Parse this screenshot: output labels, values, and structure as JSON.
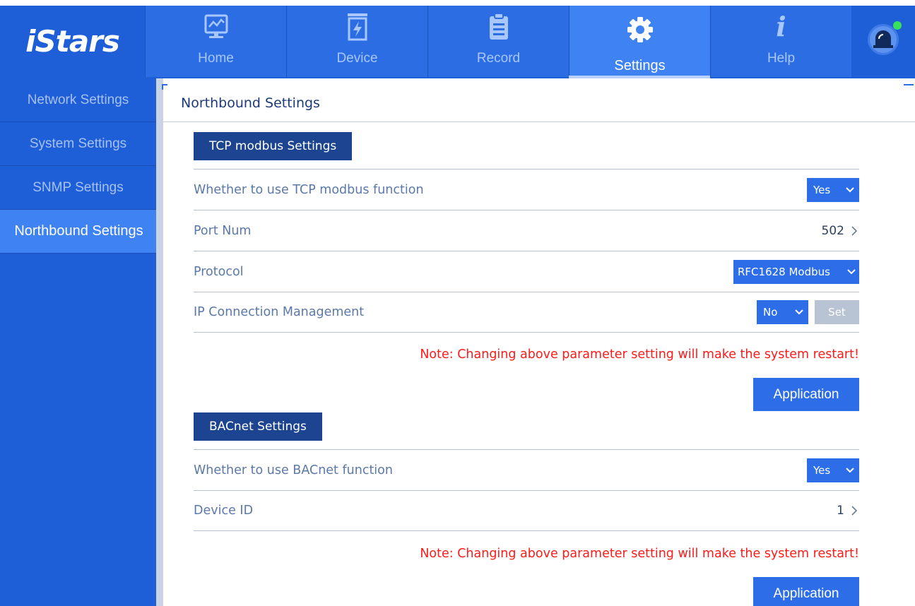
{
  "brand": {
    "logo_text": "iStars"
  },
  "nav": {
    "items": [
      {
        "label": "Home",
        "icon": "monitor-chart-icon"
      },
      {
        "label": "Device",
        "icon": "battery-bolt-icon"
      },
      {
        "label": "Record",
        "icon": "clipboard-icon"
      },
      {
        "label": "Settings",
        "icon": "gear-icon",
        "active": true
      },
      {
        "label": "Help",
        "icon": "info-icon"
      }
    ],
    "alarm": {
      "icon": "alarm-light-icon",
      "status_color": "#39e05c"
    }
  },
  "sidebar": {
    "items": [
      {
        "label": "Network Settings"
      },
      {
        "label": "System Settings"
      },
      {
        "label": "SNMP Settings"
      },
      {
        "label": "Northbound Settings",
        "active": true
      }
    ]
  },
  "page": {
    "title": "Northbound Settings"
  },
  "tcp": {
    "heading": "TCP modbus Settings",
    "use_label": "Whether to use TCP modbus function",
    "use_value": "Yes",
    "port_label": "Port Num",
    "port_value": "502",
    "protocol_label": "Protocol",
    "protocol_value": "RFC1628 Modbus",
    "ipmgmt_label": "IP Connection Management",
    "ipmgmt_value": "No",
    "set_label": "Set",
    "note": "Note: Changing above parameter setting will make the system restart!",
    "apply_label": "Application"
  },
  "bacnet": {
    "heading": "BACnet Settings",
    "use_label": "Whether to use BACnet function",
    "use_value": "Yes",
    "device_label": "Device ID",
    "device_value": "1",
    "note": "Note: Changing above parameter setting will make the system restart!",
    "apply_label": "Application"
  },
  "colors": {
    "nav_bg": "#1e5fd8",
    "nav_active": "#3f82f2",
    "accent": "#2d6ee8",
    "section_head": "#1c4491",
    "warning": "#ff1a1a"
  }
}
